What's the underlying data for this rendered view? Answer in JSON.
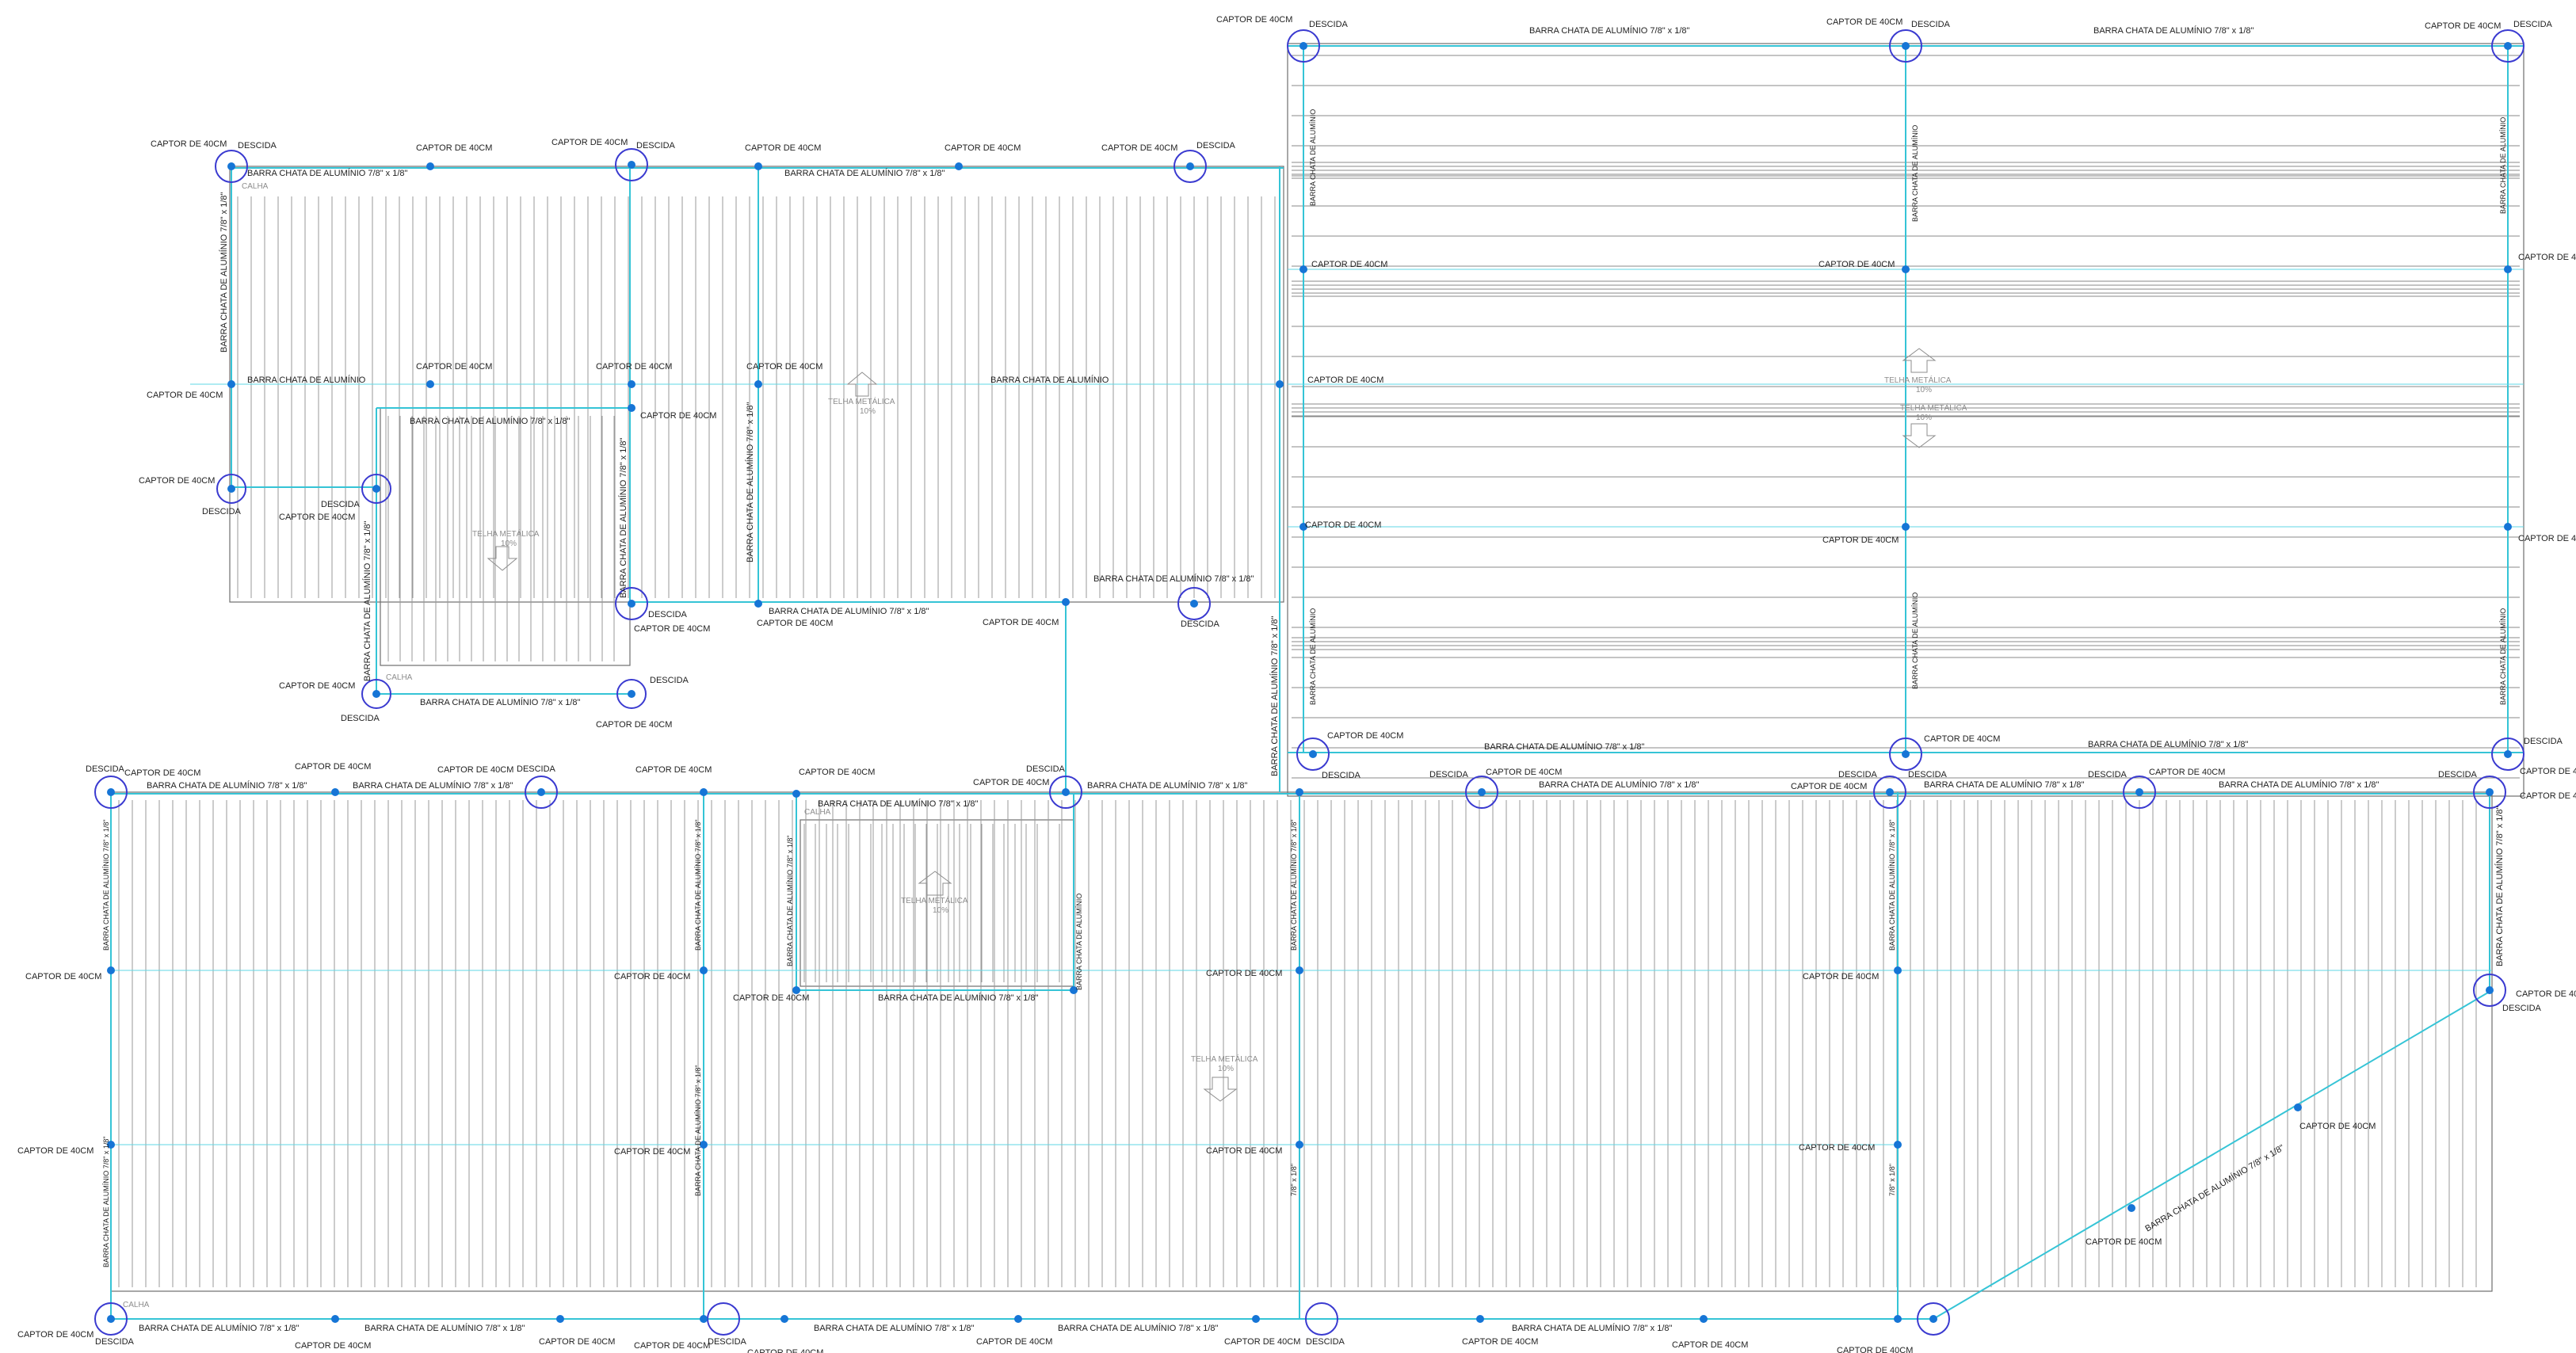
{
  "labels": {
    "captor": "CAPTOR DE 40CM",
    "captor_cut": "CAPTOR DE 4",
    "captor_cut2": "CAPTOR DE 40C",
    "descida": "DESCIDA",
    "barra_full": "BARRA CHATA DE ALUMÍNIO  7/8\" x 1/8\"",
    "barra_short": "BARRA CHATA DE ALUMÍNIO",
    "barra_vert": "BARRA CHATA DE ALUMÍNIO  7/8\" x 1/8\"",
    "barra_dim": "7/8\" x 1/8\"",
    "calha": "CALHA",
    "telha": "TELHA  METÁLICA",
    "slope": "10%"
  },
  "colors": {
    "conductor": "#35c4d6",
    "node": "#1675d6",
    "ring": "#3a3ad0",
    "roof_line": "#6f6f6f"
  },
  "icons": [
    "slope-arrow-up-icon",
    "slope-arrow-down-icon",
    "descida-ring-icon",
    "captor-node-icon"
  ]
}
